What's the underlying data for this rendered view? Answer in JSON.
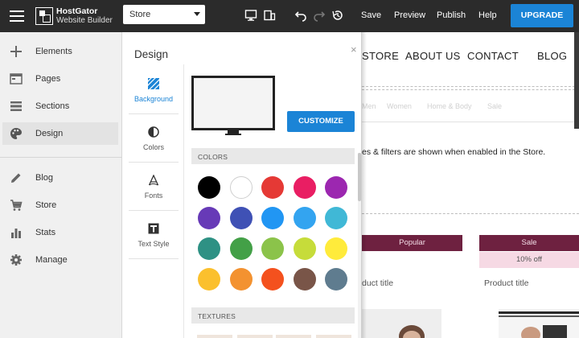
{
  "topbar": {
    "logo_line1": "HostGator",
    "logo_line2": "Website Builder",
    "page_select_value": "Store",
    "links": {
      "save": "Save",
      "preview": "Preview",
      "publish": "Publish",
      "help": "Help"
    },
    "upgrade_label": "UPGRADE",
    "accent_color": "#1b84d6"
  },
  "sidebar": {
    "items": [
      {
        "label": "Elements",
        "icon": "plus-icon"
      },
      {
        "label": "Pages",
        "icon": "pages-icon"
      },
      {
        "label": "Sections",
        "icon": "sections-icon"
      },
      {
        "label": "Design",
        "icon": "palette-icon",
        "active": true
      },
      {
        "label": "Blog",
        "icon": "pencil-icon"
      },
      {
        "label": "Store",
        "icon": "cart-icon"
      },
      {
        "label": "Stats",
        "icon": "bar-chart-icon"
      },
      {
        "label": "Manage",
        "icon": "gear-icon"
      }
    ]
  },
  "design_panel": {
    "title": "Design",
    "close": "×",
    "tabs": [
      {
        "label": "Background",
        "icon": "background-hatch-icon",
        "active": true
      },
      {
        "label": "Colors",
        "icon": "color-drop-icon"
      },
      {
        "label": "Fonts",
        "icon": "font-icon"
      },
      {
        "label": "Text Style",
        "icon": "text-style-icon"
      }
    ],
    "customize_label": "CUSTOMIZE",
    "colors_header": "COLORS",
    "textures_header": "TEXTURES",
    "swatches": [
      "#000000",
      "#ffffff",
      "#e53935",
      "#e91e63",
      "#9c27b0",
      "#673ab7",
      "#3f51b5",
      "#2196f3",
      "#33a4f0",
      "#40b8d6",
      "#2e9184",
      "#43a047",
      "#8bc34a",
      "#c6dc3a",
      "#ffeb3b",
      "#fbc02d",
      "#f39230",
      "#f4511e",
      "#795548",
      "#5f7c8f"
    ]
  },
  "preview": {
    "nav": [
      "STORE",
      "ABOUT US",
      "CONTACT",
      "BLOG"
    ],
    "categories": [
      "Men",
      "Women",
      "Home & Body",
      "Sale"
    ],
    "filter_text": "es & filters are shown when enabled in the Store.",
    "badge_left": "Popular",
    "badge_right": "Sale",
    "badge_sub": "10% off",
    "product_title_left": "duct title",
    "product_title_right": "Product title"
  }
}
